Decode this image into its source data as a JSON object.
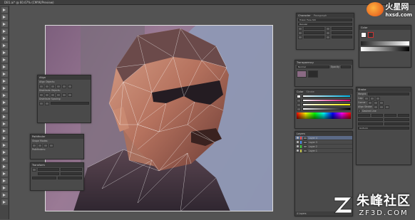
{
  "app": {
    "doc_title": "DB1.ai* @ 60.67% (CMYK/Preview)"
  },
  "toolbar": {
    "tools": [
      "selection-icon",
      "direct-selection-icon",
      "magic-wand-icon",
      "lasso-icon",
      "pen-icon",
      "type-icon",
      "line-icon",
      "rectangle-icon",
      "brush-icon",
      "pencil-icon",
      "eraser-icon",
      "rotate-icon",
      "scale-icon",
      "width-icon",
      "warp-icon",
      "free-transform-icon",
      "shape-builder-icon",
      "perspective-icon",
      "mesh-icon",
      "gradient-icon",
      "eyedropper-icon",
      "blend-icon",
      "symbol-icon",
      "graph-icon",
      "artboard-icon",
      "slice-icon",
      "hand-icon",
      "zoom-icon"
    ]
  },
  "panels": {
    "character": {
      "tabs": [
        "Character",
        "Paragraph"
      ],
      "font": "Trajan Type Std",
      "style": "Regular"
    },
    "align": {
      "title": "Align",
      "sections": [
        "Align Objects:",
        "Distribute Objects:",
        "Distribute Spacing:"
      ]
    },
    "pathfinder": {
      "title": "Pathfinder",
      "sections": [
        "Shape Modes:",
        "Pathfinders:"
      ]
    },
    "transform": {
      "title": "Transform"
    },
    "color": {
      "tabs": [
        "Color"
      ]
    },
    "transparency": {
      "title": "Transparency",
      "mode": "Normal",
      "opacity_label": "Opacity"
    },
    "stroke": {
      "tabs": [
        "Color",
        "Stroke"
      ]
    },
    "gradient": {
      "title": "Gradient"
    },
    "layers": {
      "title": "Layers",
      "items": [
        {
          "name": "Layer 4",
          "color": "#f24b4b"
        },
        {
          "name": "Layer 3",
          "color": "#4b8ff2"
        },
        {
          "name": "Layer 2",
          "color": "#3ad13a"
        },
        {
          "name": "Layer 1",
          "color": "#c8c84b"
        }
      ],
      "footer": "4 Layers"
    },
    "stroke_detail": {
      "labels": [
        "Weight:",
        "Cap:",
        "Corner:",
        "Align Stroke:",
        "Dashed Line"
      ],
      "profile": "Uniform"
    }
  },
  "watermarks": {
    "top_text": "火星网",
    "top_url": "hxsd.com",
    "bottom_text": "朱峰社区",
    "bottom_url": "ZF3D.COM"
  },
  "colors": {
    "accent": "#5b6a86",
    "workspace": "#535353",
    "panel": "#4a4a4a"
  }
}
